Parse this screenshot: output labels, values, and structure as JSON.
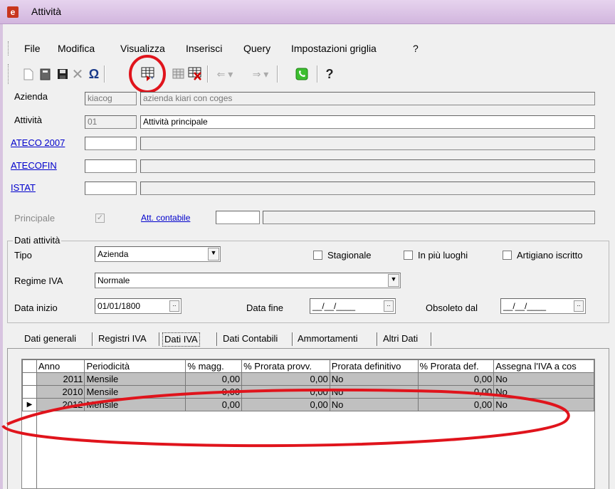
{
  "window": {
    "title": "Attività"
  },
  "menu": [
    "File",
    "Modifica",
    "Visualizza",
    "Inserisci",
    "Query",
    "Impostazioni griglia",
    "?"
  ],
  "form": {
    "azienda": {
      "label": "Azienda",
      "code": "kiacog",
      "desc": "azienda kiari con coges"
    },
    "attivita": {
      "label": "Attività",
      "code": "01",
      "desc": "Attività principale"
    },
    "ateco": {
      "label": "ATECO 2007",
      "code": "",
      "desc": ""
    },
    "atecofin": {
      "label": "ATECOFIN",
      "code": "",
      "desc": ""
    },
    "istat": {
      "label": "ISTAT",
      "code": "",
      "desc": ""
    },
    "principale": {
      "label": "Principale",
      "checked": true
    },
    "att_contabile": {
      "label": "Att. contabile",
      "code": "",
      "desc": ""
    }
  },
  "group": {
    "title": "Dati attività",
    "tipo_label": "Tipo",
    "tipo_value": "Azienda",
    "stagionale": "Stagionale",
    "in_piu_luoghi": "In più luoghi",
    "artigiano": "Artigiano iscritto",
    "regime_label": "Regime IVA",
    "regime_value": "Normale",
    "data_inizio_label": "Data inizio",
    "data_inizio_value": "01/01/1800",
    "data_fine_label": "Data fine",
    "data_fine_value": "__/__/____",
    "obsoleto_label": "Obsoleto dal",
    "obsoleto_value": "__/__/____"
  },
  "tabs": [
    "Dati generali",
    "Registri IVA",
    "Dati IVA",
    "Dati Contabili",
    "Ammortamenti",
    "Altri Dati"
  ],
  "active_tab": "Dati IVA",
  "grid": {
    "columns": [
      "Anno",
      "Periodicità",
      "% magg.",
      "% Prorata provv.",
      "Prorata definitivo",
      "% Prorata def.",
      "Assegna l'IVA a cos"
    ],
    "rows": [
      [
        "2011",
        "Mensile",
        "0,00",
        "0,00",
        "No",
        "0,00",
        "No"
      ],
      [
        "2010",
        "Mensile",
        "0,00",
        "0,00",
        "No",
        "0,00",
        "No"
      ],
      [
        "2012",
        "Mensile",
        "0,00",
        "0,00",
        "No",
        "0,00",
        "No"
      ]
    ]
  },
  "colors": {
    "annotation": "#e0141c",
    "link": "#0000cc",
    "titlebar": "#d8bfe3"
  }
}
